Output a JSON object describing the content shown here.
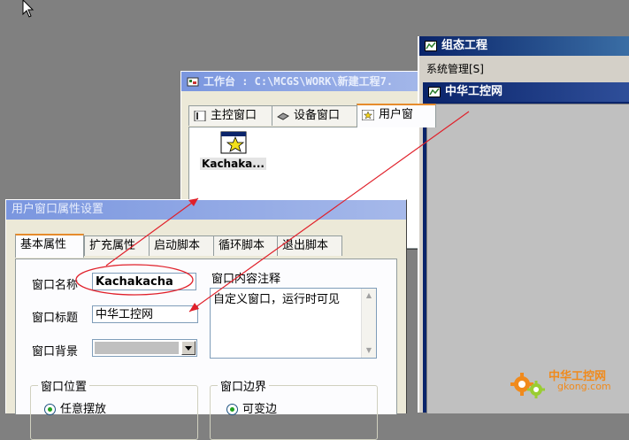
{
  "workbench": {
    "title": "工作台 : C:\\MCGS\\WORK\\新建工程7.",
    "tabs": [
      "主控窗口",
      "设备窗口",
      "用户窗"
    ],
    "item_label": "Kachaka..."
  },
  "scada": {
    "title": "组态工程",
    "menu": "系统管理[S]",
    "child_title": "中华工控网"
  },
  "dialog": {
    "title": "用户窗口属性设置",
    "tabs": [
      "基本属性",
      "扩充属性",
      "启动脚本",
      "循环脚本",
      "退出脚本"
    ],
    "name_label": "窗口名称",
    "name_value": "Kachakacha",
    "caption_label": "窗口标题",
    "caption_value": "中华工控网",
    "bg_label": "窗口背景",
    "comment_label": "窗口内容注释",
    "comment_value": "自定义窗口，运行时可见",
    "position_group": "窗口位置",
    "position_option": "任意摆放",
    "border_group": "窗口边界",
    "border_option": "可变边"
  },
  "watermark": {
    "cn": "中华工控网",
    "url": "gkong.com"
  },
  "colors": {
    "annotation": "#e0202a",
    "active_titlebar": "#0a246a",
    "inactive_titlebar": "#7a96df"
  }
}
